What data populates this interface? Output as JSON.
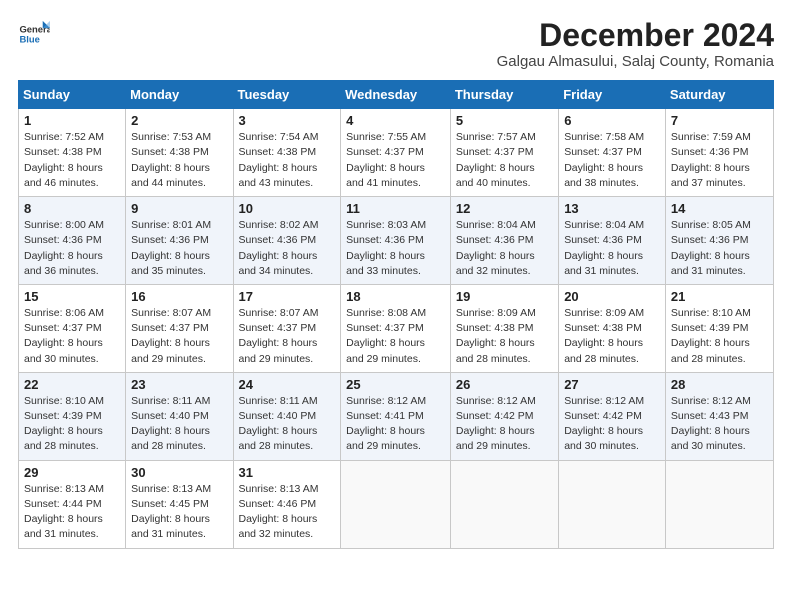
{
  "header": {
    "title": "December 2024",
    "subtitle": "Galgau Almasului, Salaj County, Romania"
  },
  "columns": [
    "Sunday",
    "Monday",
    "Tuesday",
    "Wednesday",
    "Thursday",
    "Friday",
    "Saturday"
  ],
  "weeks": [
    [
      {
        "day": "1",
        "sunrise": "Sunrise: 7:52 AM",
        "sunset": "Sunset: 4:38 PM",
        "daylight": "Daylight: 8 hours and 46 minutes."
      },
      {
        "day": "2",
        "sunrise": "Sunrise: 7:53 AM",
        "sunset": "Sunset: 4:38 PM",
        "daylight": "Daylight: 8 hours and 44 minutes."
      },
      {
        "day": "3",
        "sunrise": "Sunrise: 7:54 AM",
        "sunset": "Sunset: 4:38 PM",
        "daylight": "Daylight: 8 hours and 43 minutes."
      },
      {
        "day": "4",
        "sunrise": "Sunrise: 7:55 AM",
        "sunset": "Sunset: 4:37 PM",
        "daylight": "Daylight: 8 hours and 41 minutes."
      },
      {
        "day": "5",
        "sunrise": "Sunrise: 7:57 AM",
        "sunset": "Sunset: 4:37 PM",
        "daylight": "Daylight: 8 hours and 40 minutes."
      },
      {
        "day": "6",
        "sunrise": "Sunrise: 7:58 AM",
        "sunset": "Sunset: 4:37 PM",
        "daylight": "Daylight: 8 hours and 38 minutes."
      },
      {
        "day": "7",
        "sunrise": "Sunrise: 7:59 AM",
        "sunset": "Sunset: 4:36 PM",
        "daylight": "Daylight: 8 hours and 37 minutes."
      }
    ],
    [
      {
        "day": "8",
        "sunrise": "Sunrise: 8:00 AM",
        "sunset": "Sunset: 4:36 PM",
        "daylight": "Daylight: 8 hours and 36 minutes."
      },
      {
        "day": "9",
        "sunrise": "Sunrise: 8:01 AM",
        "sunset": "Sunset: 4:36 PM",
        "daylight": "Daylight: 8 hours and 35 minutes."
      },
      {
        "day": "10",
        "sunrise": "Sunrise: 8:02 AM",
        "sunset": "Sunset: 4:36 PM",
        "daylight": "Daylight: 8 hours and 34 minutes."
      },
      {
        "day": "11",
        "sunrise": "Sunrise: 8:03 AM",
        "sunset": "Sunset: 4:36 PM",
        "daylight": "Daylight: 8 hours and 33 minutes."
      },
      {
        "day": "12",
        "sunrise": "Sunrise: 8:04 AM",
        "sunset": "Sunset: 4:36 PM",
        "daylight": "Daylight: 8 hours and 32 minutes."
      },
      {
        "day": "13",
        "sunrise": "Sunrise: 8:04 AM",
        "sunset": "Sunset: 4:36 PM",
        "daylight": "Daylight: 8 hours and 31 minutes."
      },
      {
        "day": "14",
        "sunrise": "Sunrise: 8:05 AM",
        "sunset": "Sunset: 4:36 PM",
        "daylight": "Daylight: 8 hours and 31 minutes."
      }
    ],
    [
      {
        "day": "15",
        "sunrise": "Sunrise: 8:06 AM",
        "sunset": "Sunset: 4:37 PM",
        "daylight": "Daylight: 8 hours and 30 minutes."
      },
      {
        "day": "16",
        "sunrise": "Sunrise: 8:07 AM",
        "sunset": "Sunset: 4:37 PM",
        "daylight": "Daylight: 8 hours and 29 minutes."
      },
      {
        "day": "17",
        "sunrise": "Sunrise: 8:07 AM",
        "sunset": "Sunset: 4:37 PM",
        "daylight": "Daylight: 8 hours and 29 minutes."
      },
      {
        "day": "18",
        "sunrise": "Sunrise: 8:08 AM",
        "sunset": "Sunset: 4:37 PM",
        "daylight": "Daylight: 8 hours and 29 minutes."
      },
      {
        "day": "19",
        "sunrise": "Sunrise: 8:09 AM",
        "sunset": "Sunset: 4:38 PM",
        "daylight": "Daylight: 8 hours and 28 minutes."
      },
      {
        "day": "20",
        "sunrise": "Sunrise: 8:09 AM",
        "sunset": "Sunset: 4:38 PM",
        "daylight": "Daylight: 8 hours and 28 minutes."
      },
      {
        "day": "21",
        "sunrise": "Sunrise: 8:10 AM",
        "sunset": "Sunset: 4:39 PM",
        "daylight": "Daylight: 8 hours and 28 minutes."
      }
    ],
    [
      {
        "day": "22",
        "sunrise": "Sunrise: 8:10 AM",
        "sunset": "Sunset: 4:39 PM",
        "daylight": "Daylight: 8 hours and 28 minutes."
      },
      {
        "day": "23",
        "sunrise": "Sunrise: 8:11 AM",
        "sunset": "Sunset: 4:40 PM",
        "daylight": "Daylight: 8 hours and 28 minutes."
      },
      {
        "day": "24",
        "sunrise": "Sunrise: 8:11 AM",
        "sunset": "Sunset: 4:40 PM",
        "daylight": "Daylight: 8 hours and 28 minutes."
      },
      {
        "day": "25",
        "sunrise": "Sunrise: 8:12 AM",
        "sunset": "Sunset: 4:41 PM",
        "daylight": "Daylight: 8 hours and 29 minutes."
      },
      {
        "day": "26",
        "sunrise": "Sunrise: 8:12 AM",
        "sunset": "Sunset: 4:42 PM",
        "daylight": "Daylight: 8 hours and 29 minutes."
      },
      {
        "day": "27",
        "sunrise": "Sunrise: 8:12 AM",
        "sunset": "Sunset: 4:42 PM",
        "daylight": "Daylight: 8 hours and 30 minutes."
      },
      {
        "day": "28",
        "sunrise": "Sunrise: 8:12 AM",
        "sunset": "Sunset: 4:43 PM",
        "daylight": "Daylight: 8 hours and 30 minutes."
      }
    ],
    [
      {
        "day": "29",
        "sunrise": "Sunrise: 8:13 AM",
        "sunset": "Sunset: 4:44 PM",
        "daylight": "Daylight: 8 hours and 31 minutes."
      },
      {
        "day": "30",
        "sunrise": "Sunrise: 8:13 AM",
        "sunset": "Sunset: 4:45 PM",
        "daylight": "Daylight: 8 hours and 31 minutes."
      },
      {
        "day": "31",
        "sunrise": "Sunrise: 8:13 AM",
        "sunset": "Sunset: 4:46 PM",
        "daylight": "Daylight: 8 hours and 32 minutes."
      },
      null,
      null,
      null,
      null
    ]
  ]
}
